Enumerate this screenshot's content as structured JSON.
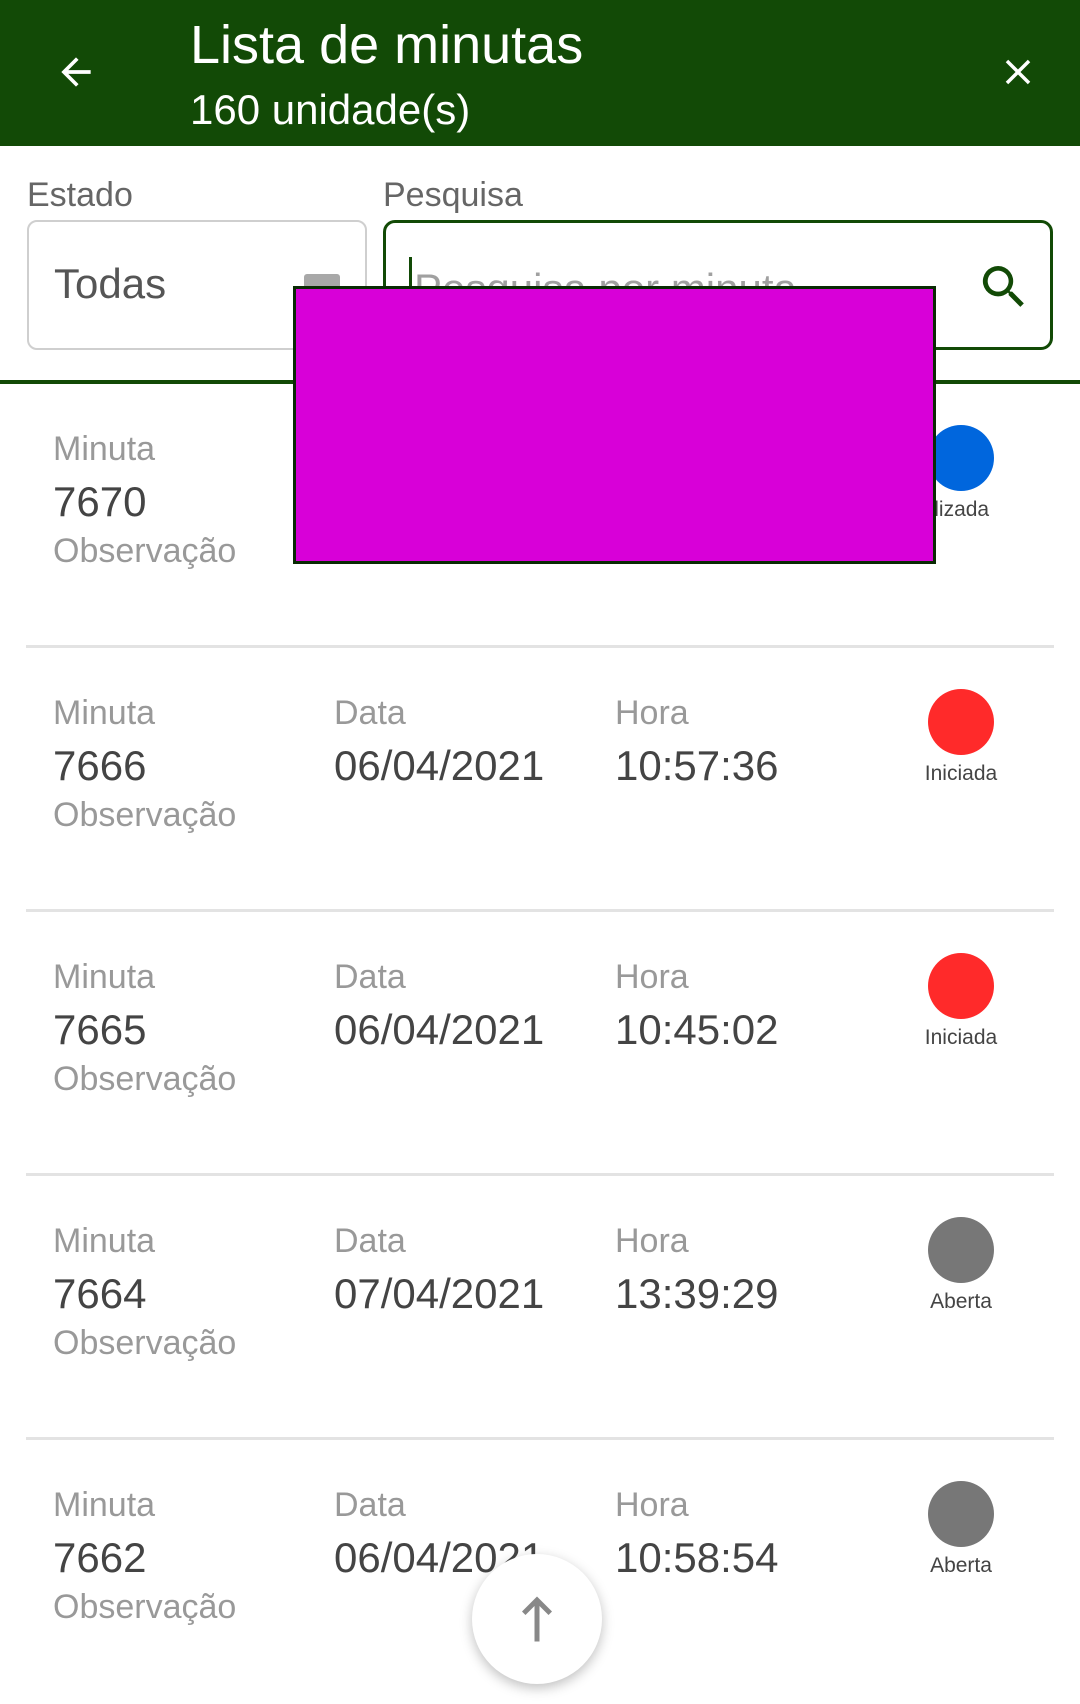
{
  "header": {
    "title": "Lista de minutas",
    "subtitle": "160 unidade(s)",
    "back_icon": "arrow-left-icon",
    "close_icon": "close-icon",
    "background_color": "#124a06"
  },
  "filters": {
    "estado_label": "Estado",
    "estado_value": "Todas",
    "pesquisa_label": "Pesquisa",
    "pesquisa_placeholder": "Pesquisa por minuta",
    "search_icon": "search-icon"
  },
  "list": {
    "labels": {
      "minuta": "Minuta",
      "data": "Data",
      "hora": "Hora",
      "observacao": "Observação"
    },
    "items": [
      {
        "minuta": "7670",
        "data": "",
        "hora": "",
        "status": "Finalizada",
        "status_visible": "nalizada",
        "status_color": "#0066dd"
      },
      {
        "minuta": "7666",
        "data": "06/04/2021",
        "hora": "10:57:36",
        "status": "Iniciada",
        "status_color": "#ff2a2a"
      },
      {
        "minuta": "7665",
        "data": "06/04/2021",
        "hora": "10:45:02",
        "status": "Iniciada",
        "status_color": "#ff2a2a"
      },
      {
        "minuta": "7664",
        "data": "07/04/2021",
        "hora": "13:39:29",
        "status": "Aberta",
        "status_color": "#777777"
      },
      {
        "minuta": "7662",
        "data": "06/04/2021",
        "hora": "10:58:54",
        "status": "Aberta",
        "status_color": "#777777"
      }
    ]
  },
  "overlay_color": "#d800d8",
  "fab": {
    "icon": "arrow-up-icon"
  }
}
